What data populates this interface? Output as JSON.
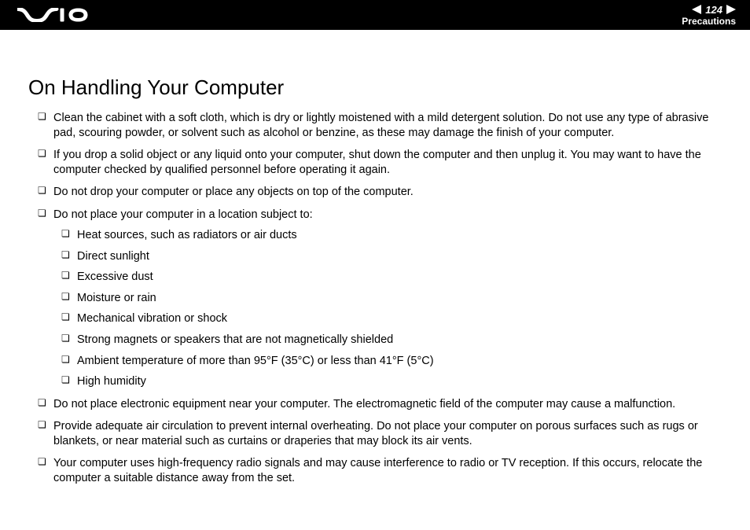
{
  "header": {
    "page_number": "124",
    "section": "Precautions"
  },
  "title": "On Handling Your Computer",
  "bullets": {
    "b1": "Clean the cabinet with a soft cloth, which is dry or lightly moistened with a mild detergent solution. Do not use any type of abrasive pad, scouring powder, or solvent such as alcohol or benzine, as these may damage the finish of your computer.",
    "b2": "If you drop a solid object or any liquid onto your computer, shut down the computer and then unplug it. You may want to have the computer checked by qualified personnel before operating it again.",
    "b3": "Do not drop your computer or place any objects on top of the computer.",
    "b4": "Do not place your computer in a location subject to:",
    "b5": "Do not place electronic equipment near your computer. The electromagnetic field of the computer may cause a malfunction.",
    "b6": "Provide adequate air circulation to prevent internal overheating. Do not place your computer on porous surfaces such as rugs or blankets, or near material such as curtains or draperies that may block its air vents.",
    "b7": "Your computer uses high-frequency radio signals and may cause interference to radio or TV reception. If this occurs, relocate the computer a suitable distance away from the set."
  },
  "sub": {
    "s1": "Heat sources, such as radiators or air ducts",
    "s2": "Direct sunlight",
    "s3": "Excessive dust",
    "s4": "Moisture or rain",
    "s5": "Mechanical vibration or shock",
    "s6": "Strong magnets or speakers that are not magnetically shielded",
    "s7": "Ambient temperature of more than 95°F (35°C) or less than 41°F (5°C)",
    "s8": "High humidity"
  }
}
